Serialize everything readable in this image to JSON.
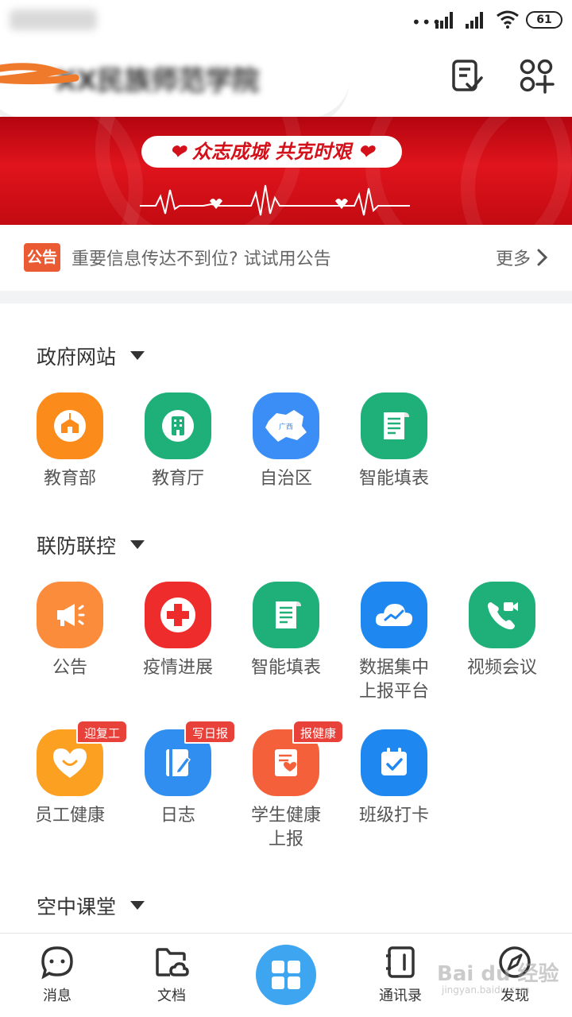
{
  "header": {
    "org_name": "XX民族师范学院"
  },
  "banner": {
    "slogan": "❤ 众志成城 共克时艰 ❤"
  },
  "notice": {
    "tag": "公告",
    "text": "重要信息传达不到位? 试试用公告",
    "more": "更多"
  },
  "statusbar": {
    "battery": "61"
  },
  "sections": [
    {
      "title": "政府网站",
      "apps": [
        {
          "label": "教育部",
          "icon": "school-icon",
          "color": "#fb8c1c"
        },
        {
          "label": "教育厅",
          "icon": "building-icon",
          "color": "#1fb07a"
        },
        {
          "label": "自治区",
          "icon": "map-guangxi-icon",
          "color": "#3a8ef6",
          "icon_text": "广西"
        },
        {
          "label": "智能填表",
          "icon": "form-scroll-icon",
          "color": "#1fb07a"
        }
      ]
    },
    {
      "title": "联防联控",
      "apps": [
        {
          "label": "公告",
          "icon": "megaphone-icon",
          "color": "#fb8c3c"
        },
        {
          "label": "疫情进展",
          "icon": "medical-cross-icon",
          "color": "#ee2c2c"
        },
        {
          "label": "智能填表",
          "icon": "form-scroll-icon",
          "color": "#1fb07a"
        },
        {
          "label": "数据集中\n上报平台",
          "label_line1": "数据集中",
          "label_line2": "上报平台",
          "icon": "cloud-chart-icon",
          "color": "#1e88f0"
        },
        {
          "label": "视频会议",
          "icon": "video-call-icon",
          "color": "#1fb07a"
        },
        {
          "label": "员工健康",
          "icon": "heart-smile-icon",
          "color": "#fba020",
          "badge": "迎复工"
        },
        {
          "label": "日志",
          "icon": "notebook-pen-icon",
          "color": "#2f8ef0",
          "badge": "写日报"
        },
        {
          "label": "学生健康\n上报",
          "label_line1": "学生健康",
          "label_line2": "上报",
          "icon": "health-report-icon",
          "color": "#f4603a",
          "badge": "报健康"
        },
        {
          "label": "班级打卡",
          "icon": "calendar-check-icon",
          "color": "#1e88f0"
        }
      ]
    },
    {
      "title": "空中课堂",
      "apps": []
    }
  ],
  "bottom_nav": {
    "messages": "消息",
    "documents": "文档",
    "contacts": "通讯录",
    "discover": "发现"
  },
  "watermark": {
    "text": "Bai du 经验",
    "sub": "jingyan.baidu.com"
  },
  "colors": {
    "accent_blue": "#3ea5f0",
    "banner_red": "#d9101a",
    "notice_tag": "#ea5a33",
    "badge_red": "#e8413a"
  }
}
